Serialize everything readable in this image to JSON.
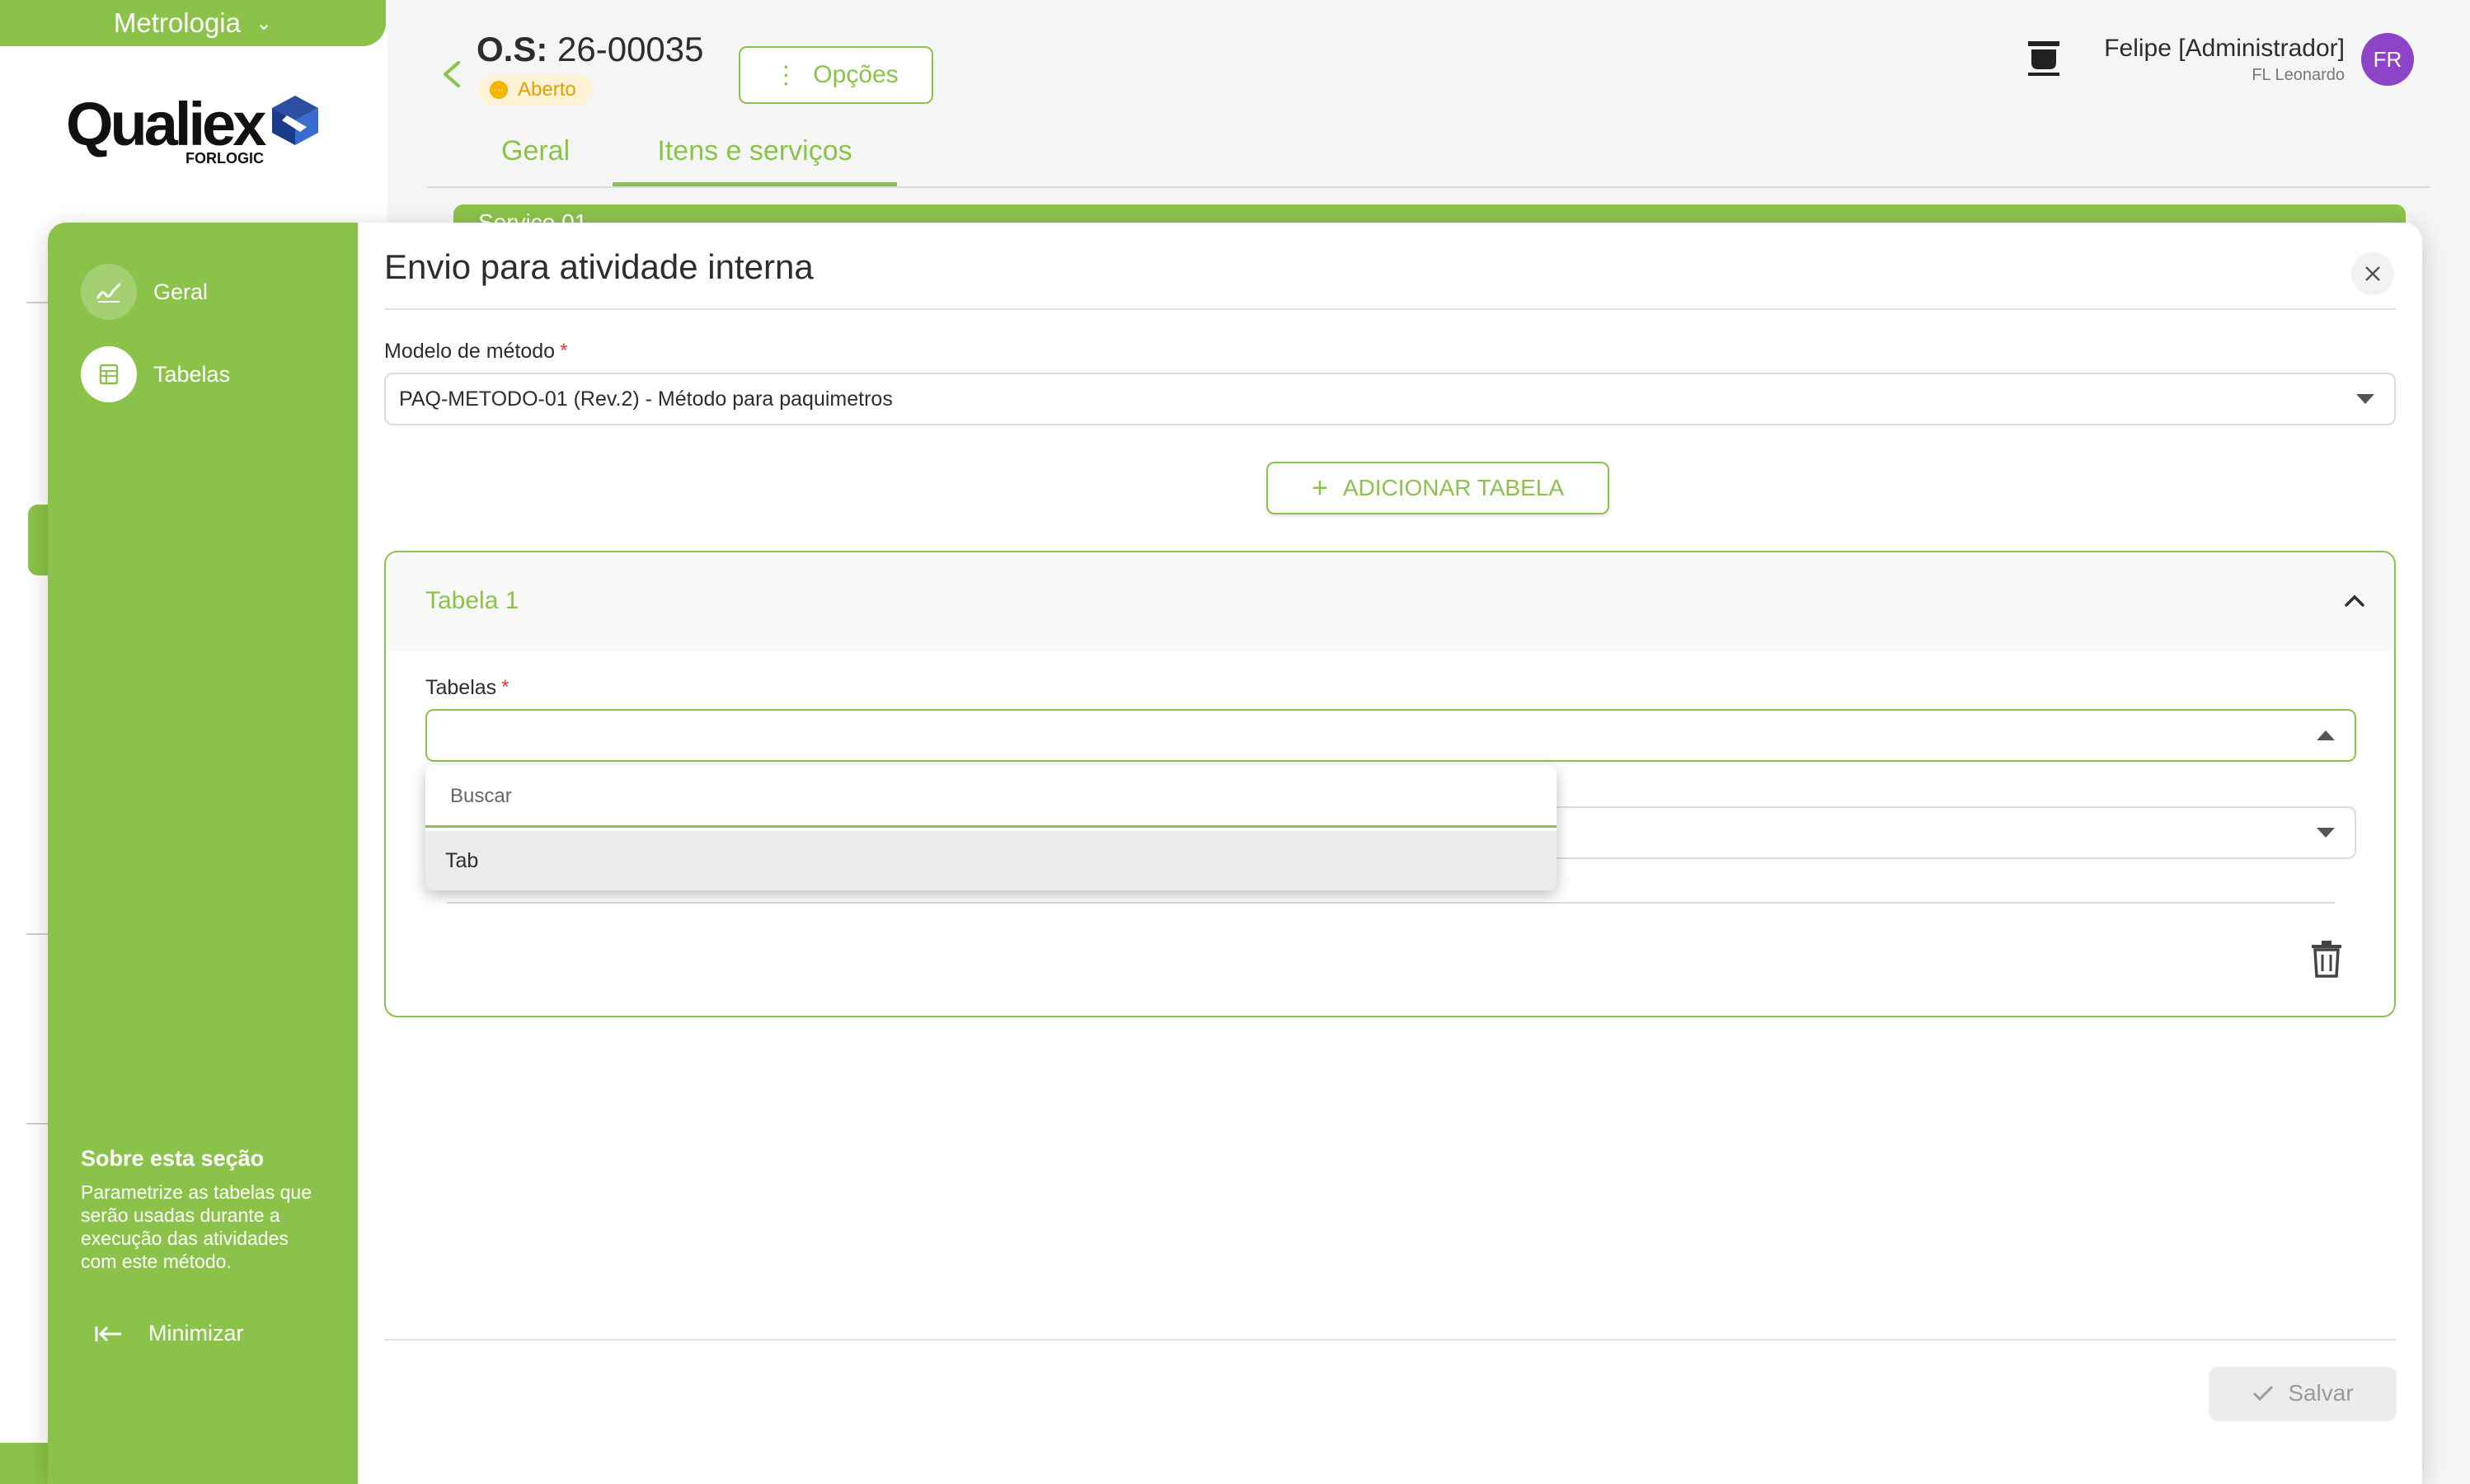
{
  "app": {
    "module": "Metrologia",
    "logo_text": "Qualiex",
    "logo_sub": "FORLOGIC"
  },
  "header": {
    "os_prefix": "O.S:",
    "os_number": "26-00035",
    "status": "Aberto",
    "options_label": "Opções",
    "user_name": "Felipe [Administrador]",
    "user_company": "FL Leonardo",
    "avatar_initials": "FR",
    "tabs": [
      {
        "label": "Geral",
        "active": false
      },
      {
        "label": "Itens e serviços",
        "active": true
      }
    ],
    "card_peek_text": "Serviço 01"
  },
  "modal": {
    "title": "Envio para atividade interna",
    "side_items": [
      {
        "label": "Geral",
        "icon": "signature-icon"
      },
      {
        "label": "Tabelas",
        "icon": "table-icon"
      }
    ],
    "about_title": "Sobre esta seção",
    "about_text": "Parametrize as tabelas que serão usadas durante a execução das atividades com este método.",
    "minimize_label": "Minimizar",
    "method_label": "Modelo de método",
    "method_value": "PAQ-METODO-01 (Rev.2) - Método para paquimetros",
    "add_table_label": "ADICIONAR TABELA",
    "table_card": {
      "title": "Tabela 1",
      "tables_label": "Tabelas",
      "tables_value": "",
      "search_placeholder": "Buscar",
      "options": [
        "Tab"
      ]
    },
    "save_label": "Salvar"
  },
  "colors": {
    "brand_green": "#8bc34a",
    "status_bg": "#fff3d6",
    "status_text": "#e0a100",
    "avatar": "#8e44c9",
    "required": "#e53935"
  }
}
